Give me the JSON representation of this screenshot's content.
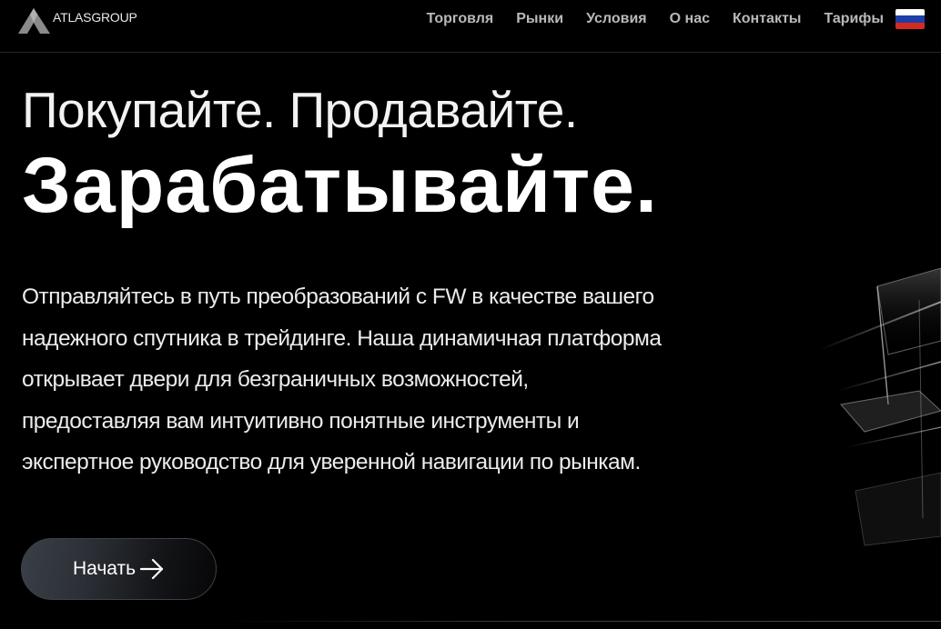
{
  "brand": {
    "name": "ATLASGROUP",
    "logo_icon": "triangle-logo-icon"
  },
  "nav": {
    "items": [
      {
        "label": "Торговля"
      },
      {
        "label": "Рынки"
      },
      {
        "label": "Условия"
      },
      {
        "label": "О нас"
      },
      {
        "label": "Контакты"
      },
      {
        "label": "Тарифы"
      }
    ],
    "language_icon": "russia-flag-icon",
    "flag_colors": [
      "#ffffff",
      "#1c3fa8",
      "#d52b1e"
    ]
  },
  "hero": {
    "line1": "Покупайте. Продавайте.",
    "line2": "Зарабатывайте.",
    "description_lines": [
      "Отправляйтесь в путь преобразований с FW в качестве вашего",
      "надежного спутника в трейдинге. Наша динамичная платформа",
      "открывает двери для безграничных возможностей,",
      "предоставляя вам интуитивно понятные инструменты и",
      "экспертное руководство для уверенной навигации по рынкам."
    ]
  },
  "cta": {
    "label": "Начать",
    "icon": "arrow-right-icon"
  },
  "colors": {
    "background": "#000000",
    "nav_text": "#b9b9b9",
    "button_gradient_start": "#3a3f47"
  }
}
